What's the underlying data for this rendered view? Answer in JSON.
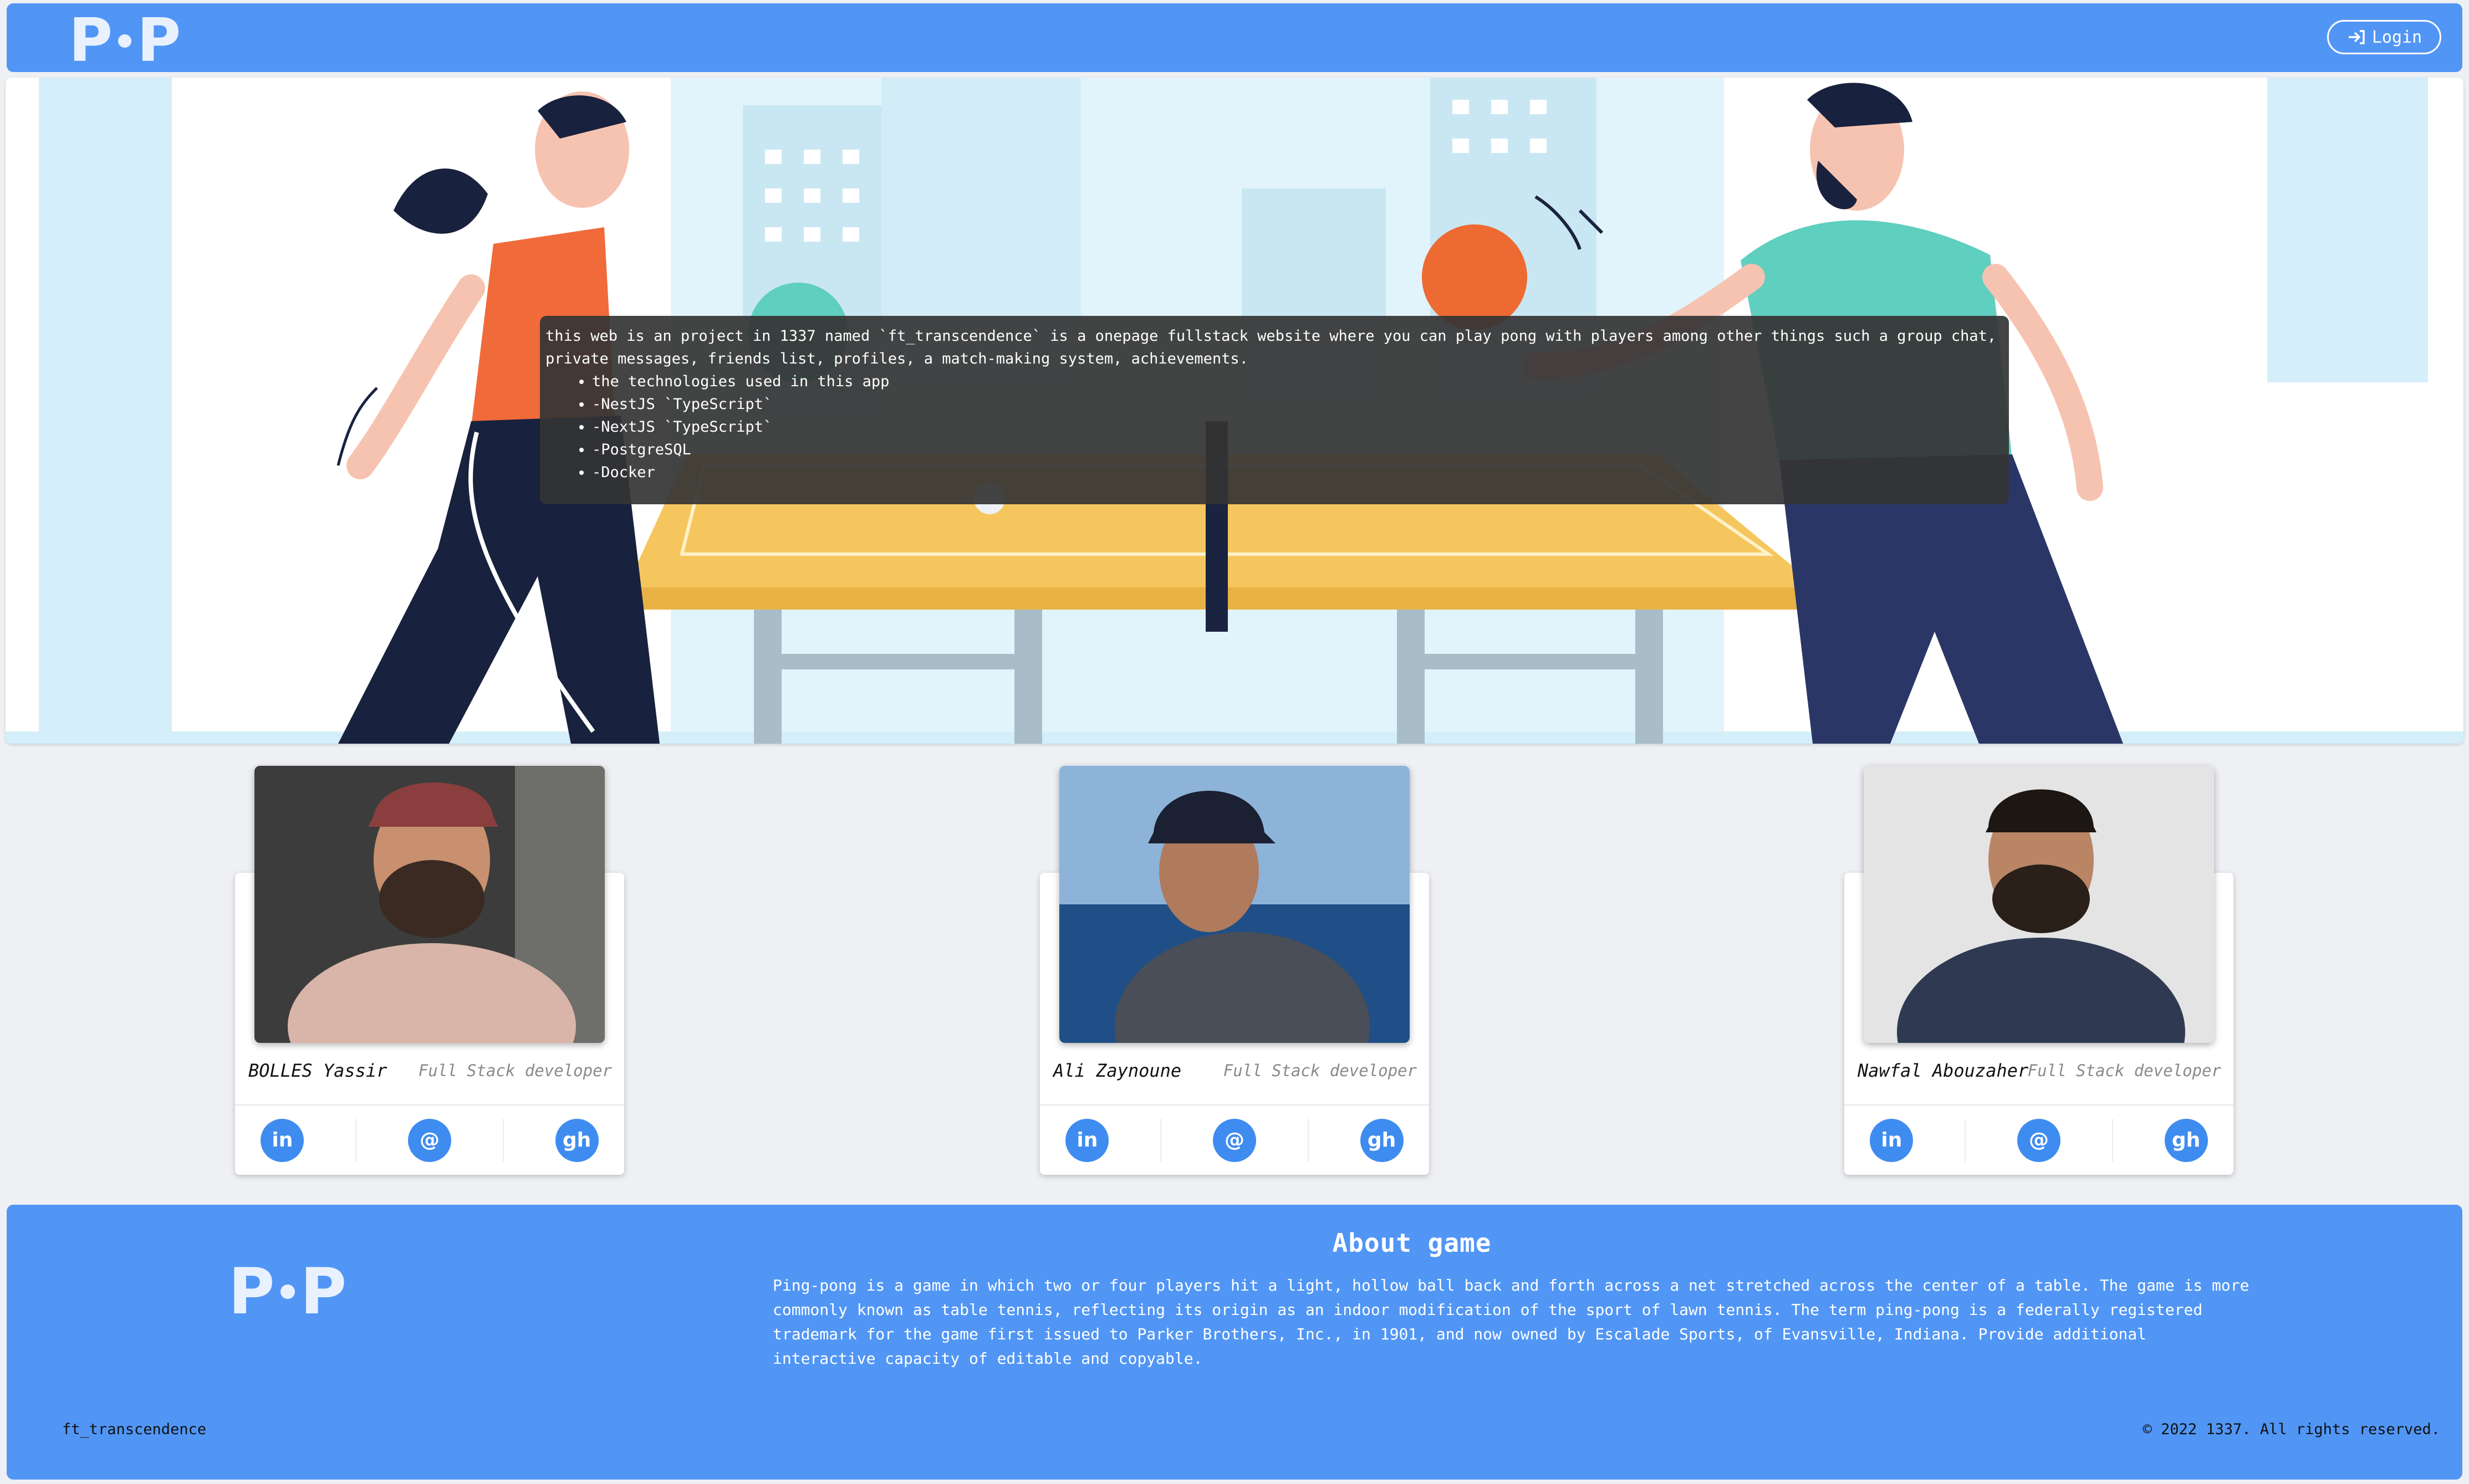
{
  "navbar": {
    "logo_left": "P",
    "logo_right": "P",
    "login_icon": "login-arrow-icon",
    "login_label": "Login"
  },
  "hero": {
    "description": "this web is an project in 1337 named `ft_transcendence` is a onepage fullstack website where you can play pong with players among other things such a group chat, private messages, friends list, profiles, a match-making system, achievements.",
    "tech_items": [
      "the technologies used in this app",
      "-NestJS `TypeScript`",
      "-NextJS `TypeScript`",
      "-PostgreSQL",
      "-Docker"
    ]
  },
  "team": [
    {
      "name": "BOLLES Yassir",
      "role": "Full Stack developer"
    },
    {
      "name": "Ali Zaynoune",
      "role": "Full Stack developer"
    },
    {
      "name": "Nawfal Abouzaher",
      "role": "Full Stack developer"
    }
  ],
  "social_icons": {
    "linkedin": "in",
    "email": "@",
    "github": "gh"
  },
  "footer": {
    "about_title": "About game",
    "about_text": "Ping-pong is a game in which two or four players hit a light, hollow ball back and forth across a net stretched across the center of a table. The game is more commonly known as table tennis, reflecting its origin as an indoor modification of the sport of lawn tennis. The term ping-pong is a federally registered trademark for the game first issued to Parker Brothers, Inc., in 1901, and now owned by Escalade Sports, of Evansville, Indiana. Provide additional interactive capacity of editable and copyable.",
    "brand": "ft_transcendence",
    "copyright": "© 2022 1337. All rights reserved."
  },
  "colors": {
    "primary": "#5196f5",
    "icon_button": "#3f8cf0",
    "page_bg": "#eef0f4"
  }
}
